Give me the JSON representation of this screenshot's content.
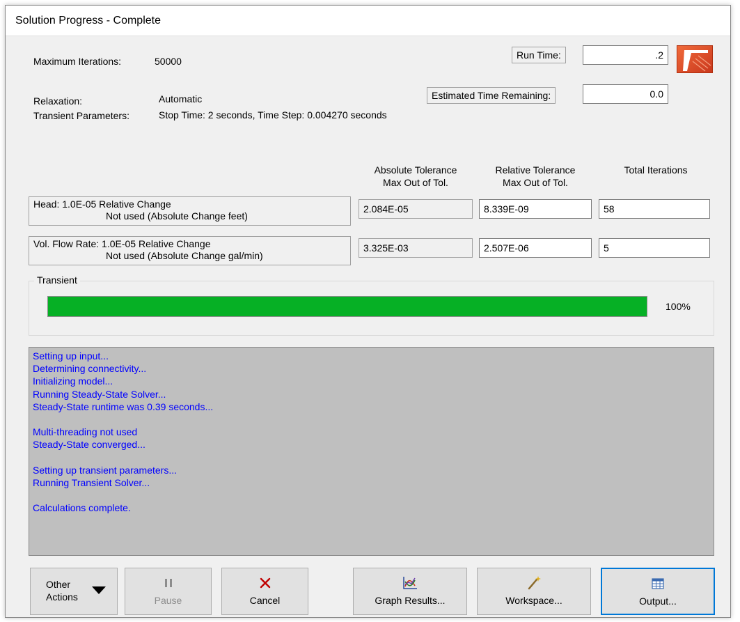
{
  "window": {
    "title": "Solution Progress - Complete"
  },
  "params": {
    "max_iterations_label": "Maximum Iterations:",
    "max_iterations_value": "50000",
    "relaxation_label": "Relaxation:",
    "relaxation_value": "Automatic",
    "transient_label": "Transient Parameters:",
    "transient_value": "Stop Time: 2 seconds, Time Step: 0.004270 seconds"
  },
  "timing": {
    "run_time_label": "Run Time:",
    "run_time_value": ".2",
    "remaining_label": "Estimated Time Remaining:",
    "remaining_value": "0.0"
  },
  "columns": {
    "abs_line1": "Absolute Tolerance",
    "abs_line2": "Max Out of Tol.",
    "rel_line1": "Relative Tolerance",
    "rel_line2": "Max Out of Tol.",
    "iter": "Total Iterations"
  },
  "rows": [
    {
      "line1": "Head: 1.0E-05 Relative Change",
      "line2": "Not used (Absolute Change feet)",
      "abs": "2.084E-05",
      "rel": "8.339E-09",
      "iter": "58"
    },
    {
      "line1": "Vol. Flow Rate: 1.0E-05 Relative Change",
      "line2": "Not used (Absolute Change gal/min)",
      "abs": "3.325E-03",
      "rel": "2.507E-06",
      "iter": "5"
    }
  ],
  "transient": {
    "label": "Transient",
    "progress": 1.0,
    "percent_text": "100%",
    "bar_color": "#06b025"
  },
  "log": [
    "Setting up input...",
    "Determining connectivity...",
    "Initializing model...",
    "Running Steady-State Solver...",
    "Steady-State runtime was 0.39 seconds...",
    "",
    "Multi-threading not used",
    "Steady-State converged...",
    "",
    "Setting up transient parameters...",
    "Running Transient Solver...",
    "",
    "Calculations complete."
  ],
  "log_text_color": "#0000ff",
  "buttons": {
    "other_actions_line1": "Other",
    "other_actions_line2": "Actions",
    "pause": "Pause",
    "cancel": "Cancel",
    "graph_results": "Graph Results...",
    "workspace": "Workspace...",
    "output": "Output..."
  },
  "icons": {
    "logo": "app-logo-icon",
    "other_actions": "dropdown-arrow-icon",
    "pause": "pause-icon",
    "cancel": "cancel-x-icon",
    "graph": "graph-icon",
    "workspace": "wand-icon",
    "output": "table-icon"
  }
}
